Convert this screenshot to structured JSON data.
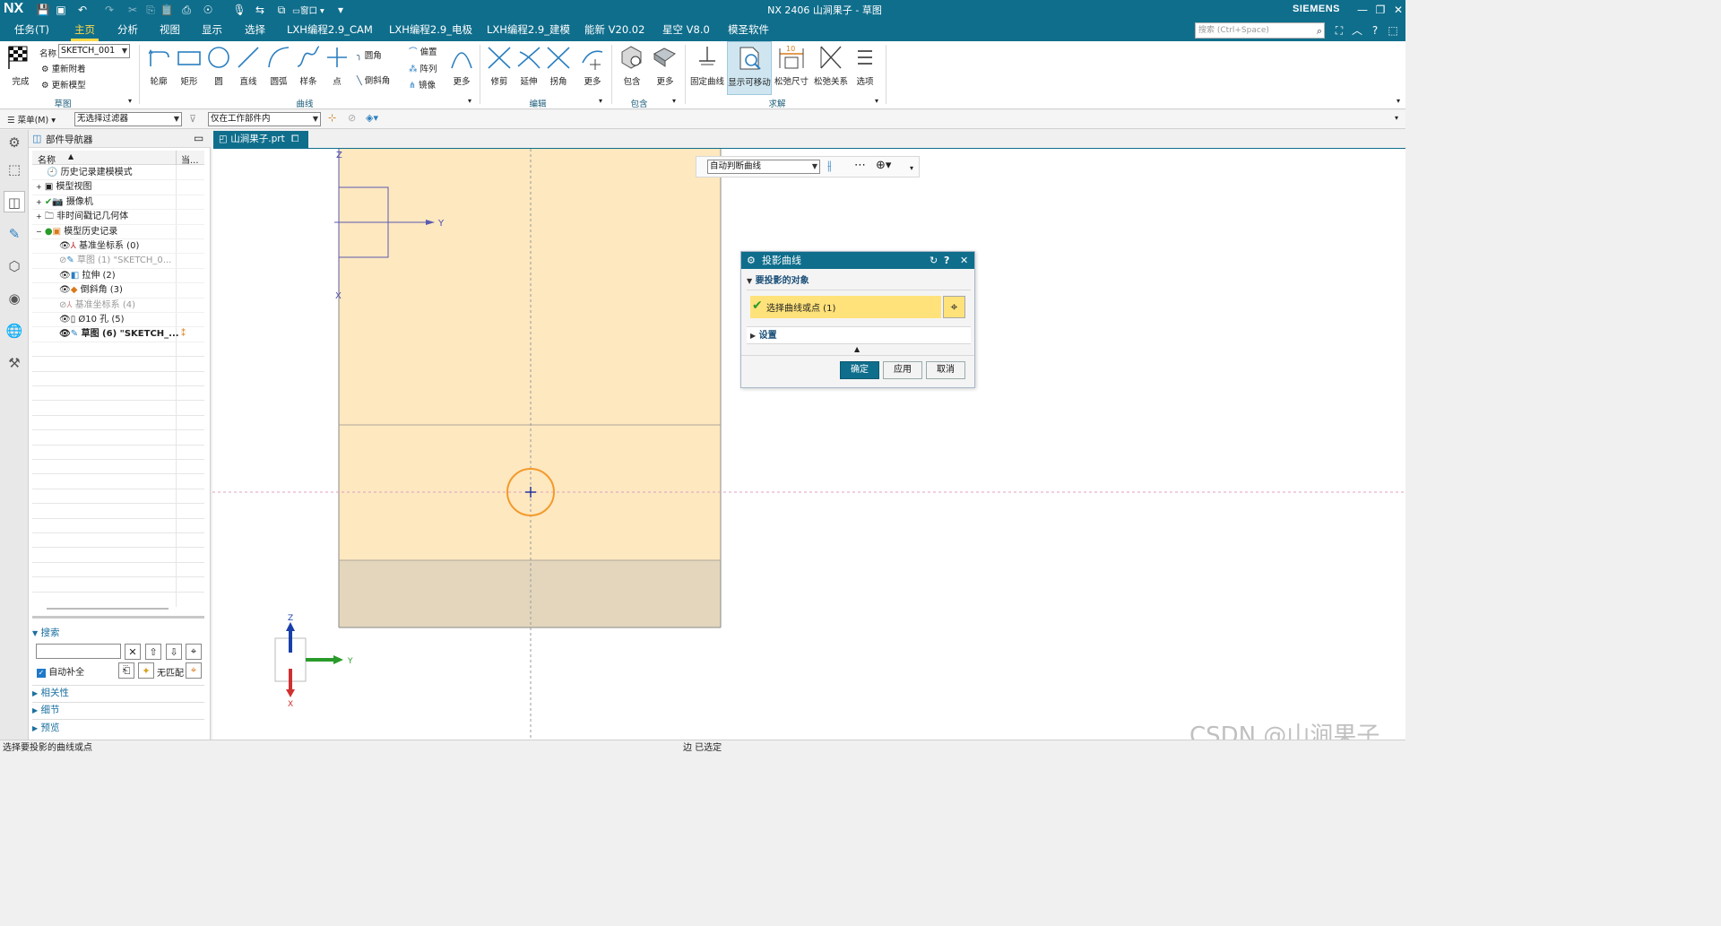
{
  "app": {
    "logo": "NX",
    "title": "NX 2406 山涧果子 - 草图",
    "brand": "SIEMENS",
    "window_menu": "窗口"
  },
  "menu": {
    "tabs": [
      "任务(T)",
      "主页",
      "分析",
      "视图",
      "显示",
      "选择",
      "LXH编程2.9_CAM",
      "LXH编程2.9_电极",
      "LXH编程2.9_建模",
      "能新 V20.02",
      "星空 V8.0",
      "模圣软件"
    ],
    "active": "主页",
    "search_placeholder": "搜索 (Ctrl+Space)"
  },
  "ribbon": {
    "sketch_group": {
      "finish": "完成",
      "name_label": "名称",
      "name_value": "SKETCH_001",
      "reattach": "重新附着",
      "update_model": "更新模型",
      "label": "草图"
    },
    "curve_group": {
      "tools": [
        "轮廓",
        "矩形",
        "圆",
        "直线",
        "圆弧",
        "样条",
        "点"
      ],
      "fillet": "圆角",
      "chamfer": "倒斜角",
      "offset": "偏置",
      "pattern": "阵列",
      "mirror": "镜像",
      "more": "更多",
      "label": "曲线"
    },
    "edit_group": {
      "tools": [
        "修剪",
        "延伸",
        "拐角"
      ],
      "more": "更多",
      "label": "编辑"
    },
    "include_group": {
      "include": "包含",
      "more": "更多",
      "label": "包含"
    },
    "solve_group": {
      "tools": [
        "固定曲线",
        "显示可移动",
        "松弛尺寸",
        "松弛关系",
        "选项"
      ],
      "label": "求解",
      "dim_badge": "10"
    }
  },
  "toolbar2": {
    "menu_label": "菜单(M)",
    "filter": "无选择过滤器",
    "scope": "仅在工作部件内"
  },
  "navigator": {
    "title": "部件导航器",
    "col_name": "名称",
    "col_current": "当...",
    "items": [
      {
        "label": "历史记录建模模式",
        "style": "normal"
      },
      {
        "label": "模型视图",
        "style": "normal"
      },
      {
        "label": "摄像机",
        "style": "normal"
      },
      {
        "label": "非时间戳记几何体",
        "style": "normal"
      },
      {
        "label": "模型历史记录",
        "style": "normal"
      },
      {
        "label": "基准坐标系 (0)",
        "style": "normal"
      },
      {
        "label": "草图 (1) \"SKETCH_0...",
        "style": "dim"
      },
      {
        "label": "拉伸 (2)",
        "style": "normal"
      },
      {
        "label": "倒斜角 (3)",
        "style": "normal"
      },
      {
        "label": "基准坐标系 (4)",
        "style": "dim"
      },
      {
        "label": "Ø10 孔 (5)",
        "style": "normal"
      },
      {
        "label": "草图 (6) \"SKETCH_...",
        "style": "bold"
      }
    ],
    "search_title": "搜索",
    "auto_complete": "自动补全",
    "no_match": "无匹配",
    "sections": [
      "相关性",
      "细节",
      "预览"
    ]
  },
  "doc_tab": "山涧果子.prt",
  "graphics": {
    "curve_rule": "自动判断曲线",
    "axis_z": "Z",
    "axis_y": "Y",
    "axis_x": "X",
    "triad_z": "Z",
    "triad_y": "Y",
    "triad_x": "X",
    "watermark": "CSDN @山涧果子"
  },
  "dialog": {
    "title": "投影曲线",
    "section_objects": "要投影的对象",
    "select_row": "选择曲线或点 (1)",
    "section_settings": "设置",
    "ok": "确定",
    "apply": "应用",
    "cancel": "取消"
  },
  "status": {
    "left": "选择要投影的曲线或点",
    "center": "边 已选定"
  },
  "colors": {
    "accent": "#0f6e8c",
    "part_fill": "#fde8c0",
    "chamfer_fill": "#e3d6bd",
    "selection_yellow": "#ffe27a",
    "hole_orange": "#f39a2c"
  }
}
